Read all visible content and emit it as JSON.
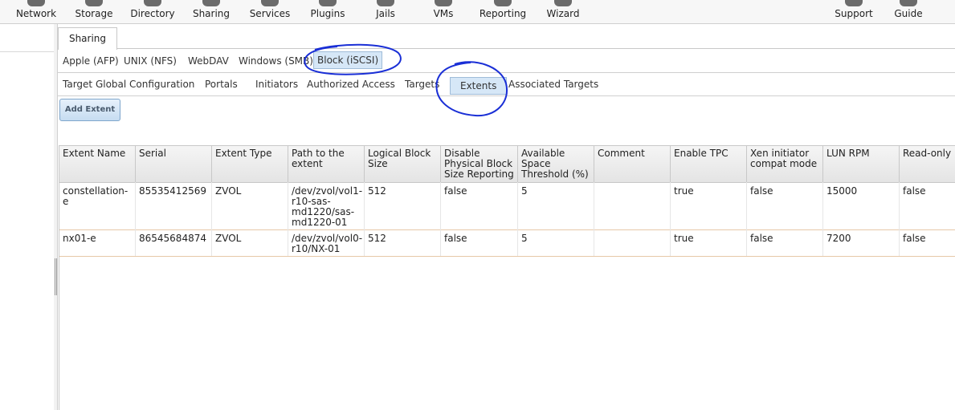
{
  "toolbar": {
    "items": [
      {
        "label": "Network",
        "icon": "network-icon"
      },
      {
        "label": "Storage",
        "icon": "storage-icon"
      },
      {
        "label": "Directory",
        "icon": "directory-icon"
      },
      {
        "label": "Sharing",
        "icon": "sharing-icon"
      },
      {
        "label": "Services",
        "icon": "services-icon"
      },
      {
        "label": "Plugins",
        "icon": "plugins-icon"
      },
      {
        "label": "Jails",
        "icon": "jails-icon"
      },
      {
        "label": "VMs",
        "icon": "vms-icon"
      },
      {
        "label": "Reporting",
        "icon": "reporting-icon"
      },
      {
        "label": "Wizard",
        "icon": "wizard-icon"
      },
      {
        "label": "Support",
        "icon": "support-icon"
      },
      {
        "label": "Guide",
        "icon": "guide-icon"
      }
    ]
  },
  "main_tab": "Sharing",
  "share_tabs": [
    "Apple (AFP)",
    "UNIX (NFS)",
    "WebDAV",
    "Windows (SMB)",
    "Block (iSCSI)"
  ],
  "iscsi_tabs": [
    "Target Global Configuration",
    "Portals",
    "Initiators",
    "Authorized Access",
    "Targets",
    "Extents",
    "Associated Targets"
  ],
  "add_button": "Add Extent",
  "table": {
    "columns": [
      [
        "Extent Name"
      ],
      [
        "Serial"
      ],
      [
        "Extent Type"
      ],
      [
        "Path to the",
        "extent"
      ],
      [
        "Logical Block",
        "Size"
      ],
      [
        "Disable",
        "Physical Block",
        "Size Reporting"
      ],
      [
        "Available",
        "Space",
        "Threshold (%)"
      ],
      [
        "Comment"
      ],
      [
        "Enable TPC"
      ],
      [
        "Xen initiator",
        "compat mode"
      ],
      [
        "LUN RPM"
      ],
      [
        "Read-only"
      ]
    ],
    "rows": [
      [
        [
          "constellation-e"
        ],
        [
          "85535412569"
        ],
        [
          "ZVOL"
        ],
        [
          "/dev/zvol/vol1-",
          "r10-sas-",
          "md1220/sas-",
          "md1220-01"
        ],
        [
          "512"
        ],
        [
          "false"
        ],
        [
          "5"
        ],
        [
          ""
        ],
        [
          "true"
        ],
        [
          "false"
        ],
        [
          "15000"
        ],
        [
          "false"
        ]
      ],
      [
        [
          "nx01-e"
        ],
        [
          "86545684874"
        ],
        [
          "ZVOL"
        ],
        [
          "/dev/zvol/vol0-",
          "r10/NX-01"
        ],
        [
          "512"
        ],
        [
          "false"
        ],
        [
          "5"
        ],
        [
          ""
        ],
        [
          "true"
        ],
        [
          "false"
        ],
        [
          "7200"
        ],
        [
          "false"
        ]
      ]
    ]
  },
  "colors": {
    "accent": "#d6e7f7",
    "annotation": "#1a2fd6"
  }
}
